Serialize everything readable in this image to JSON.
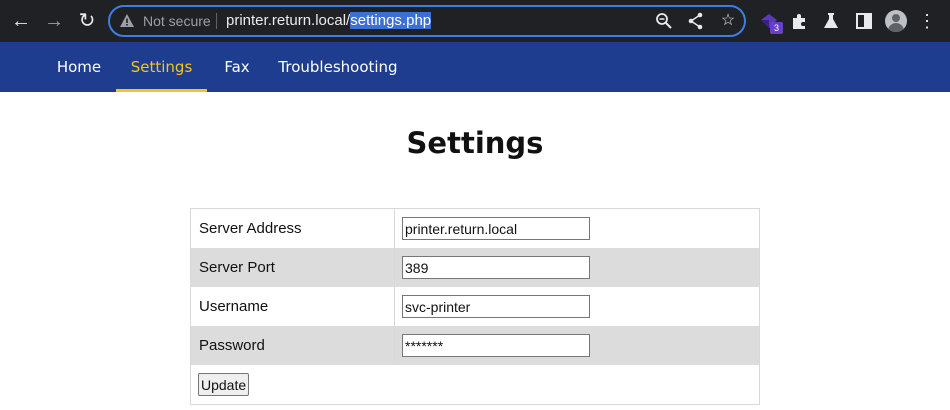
{
  "browser": {
    "security_label": "Not secure",
    "url_host": "printer.return.local/",
    "url_path": "settings.php",
    "extension_badge": "3"
  },
  "nav": {
    "items": [
      {
        "label": "Home"
      },
      {
        "label": "Settings",
        "active": true
      },
      {
        "label": "Fax"
      },
      {
        "label": "Troubleshooting"
      }
    ]
  },
  "page": {
    "title": "Settings"
  },
  "form": {
    "fields": [
      {
        "label": "Server Address",
        "value": "printer.return.local"
      },
      {
        "label": "Server Port",
        "value": "389"
      },
      {
        "label": "Username",
        "value": "svc-printer"
      },
      {
        "label": "Password",
        "value": "*******"
      }
    ],
    "submit_label": "Update"
  },
  "colors": {
    "navbar_bg": "#1e3d8f",
    "active_nav": "#f5c61a",
    "chrome_bg": "#202124",
    "row_shade": "#dcdcdc"
  }
}
